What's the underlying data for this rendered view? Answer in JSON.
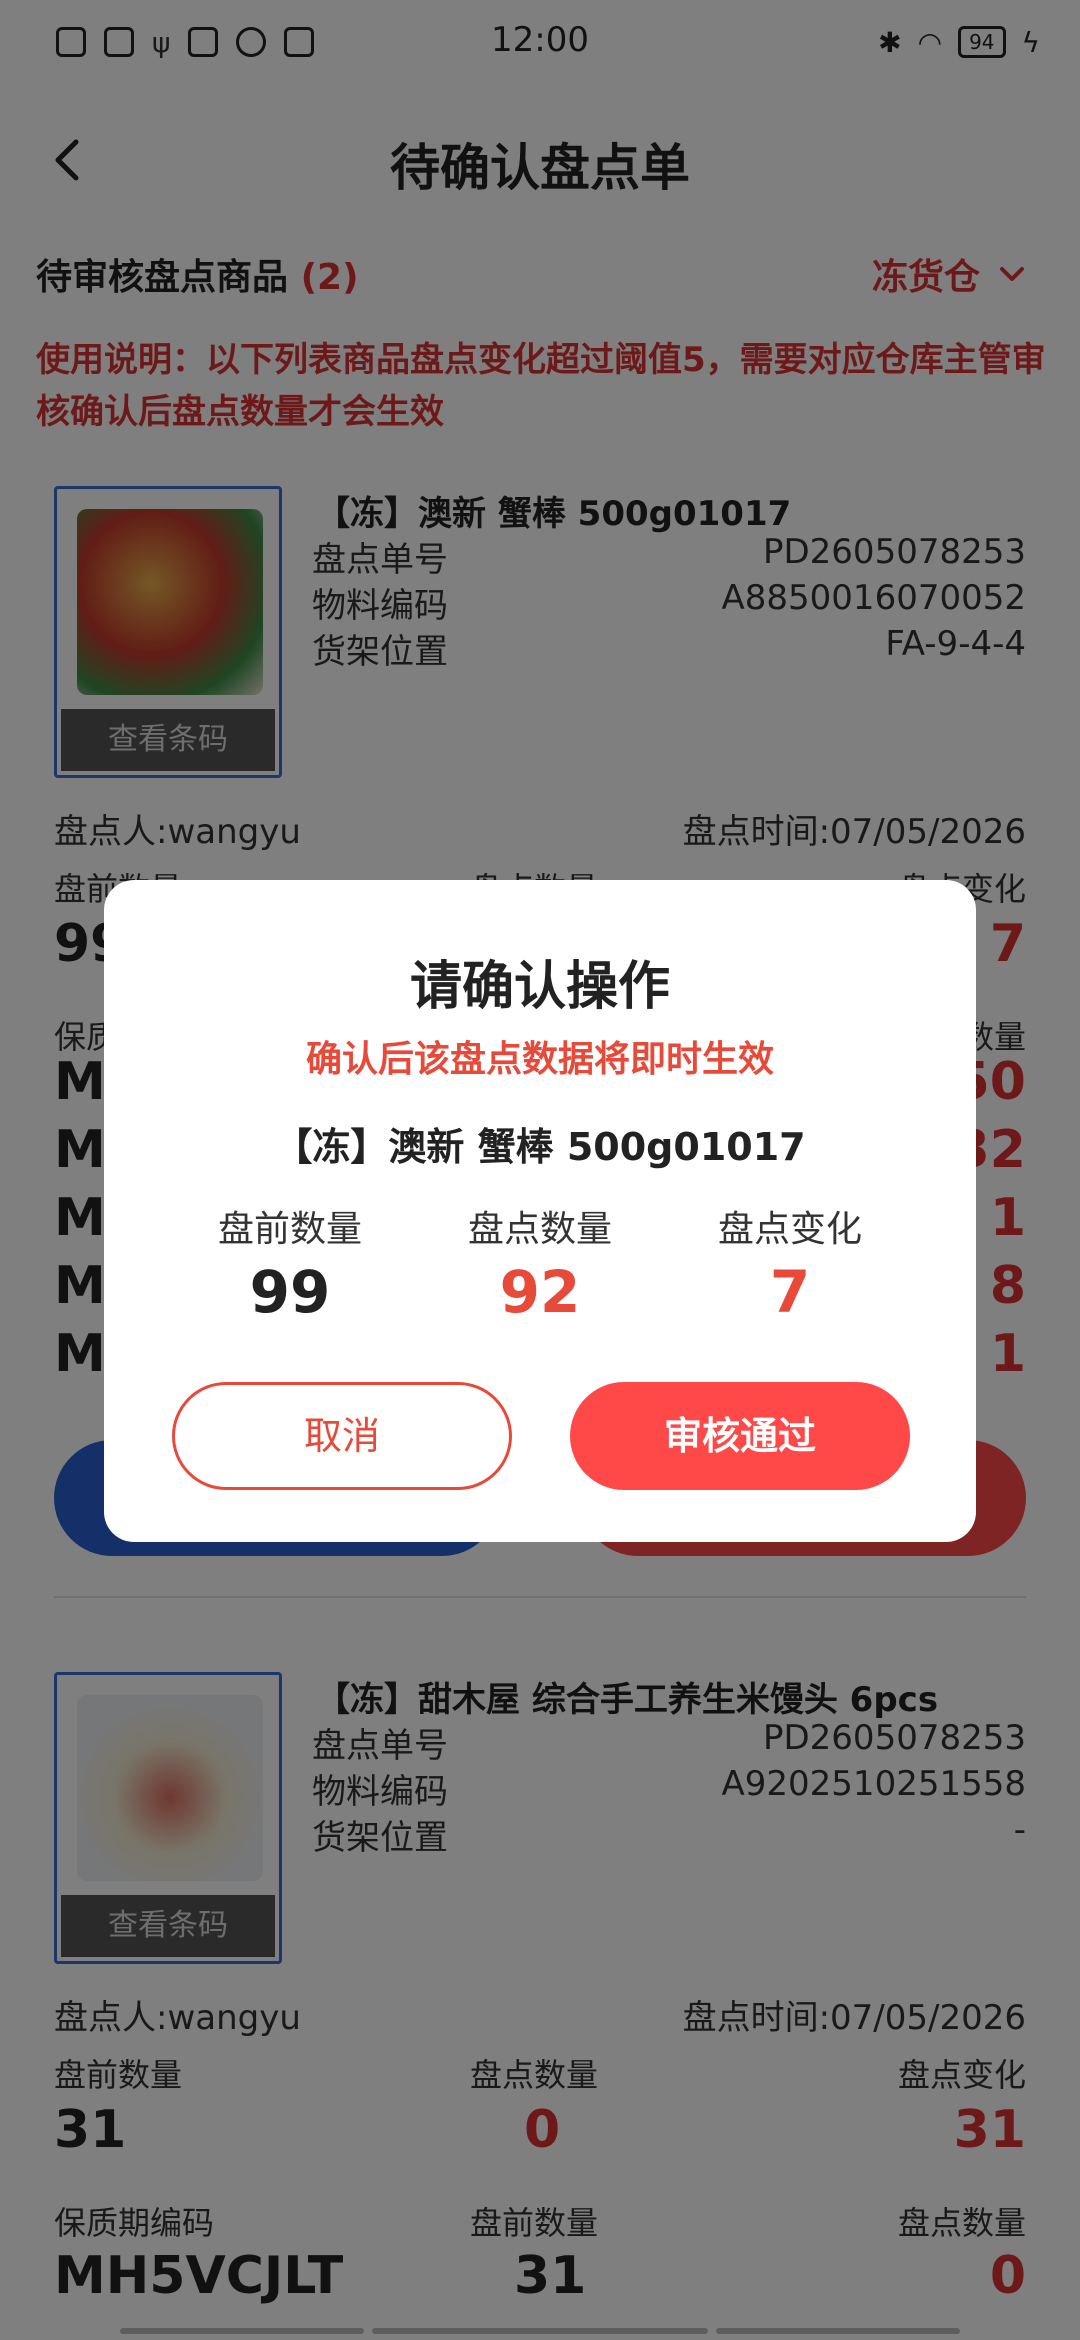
{
  "status_bar": {
    "time": "12:00",
    "battery": "94"
  },
  "header": {
    "title": "待确认盘点单",
    "back_icon": "chevron-left-icon"
  },
  "pending": {
    "label": "待审核盘点商品",
    "count": "(2)"
  },
  "warehouse": {
    "label": "冻货仓"
  },
  "notice": "使用说明：以下列表商品盘点变化超过阈值5，需要对应仓库主管审核确认后盘点数量才会生效",
  "cards": [
    {
      "name": "【冻】澳新 蟹棒 500g01017",
      "barcode_btn": "查看条码",
      "rows": [
        {
          "label": "盘点单号",
          "value": "PD2605078253"
        },
        {
          "label": "物料编码",
          "value": "A8850016070052"
        },
        {
          "label": "货架位置",
          "value": "FA-9-4-4"
        }
      ],
      "operator": "盘点人:wangyu",
      "time": "盘点时间:07/05/2026",
      "qty_labels": [
        "盘前数量",
        "盘点数量",
        "盘点变化"
      ],
      "qty_values": [
        "99",
        "92",
        "7"
      ],
      "batch_label_first": "保质",
      "batch_label_last": "数量",
      "batch_codes": [
        "M",
        "M",
        "M",
        "M",
        "M"
      ],
      "batch_values": [
        "50",
        "32",
        "1",
        "8",
        "1"
      ]
    },
    {
      "name": "【冻】甜木屋 综合手工养生米馒头 6pcs",
      "barcode_btn": "查看条码",
      "rows": [
        {
          "label": "盘点单号",
          "value": "PD2605078253"
        },
        {
          "label": "物料编码",
          "value": "A9202510251558"
        },
        {
          "label": "货架位置",
          "value": "-"
        }
      ],
      "operator": "盘点人:wangyu",
      "time": "盘点时间:07/05/2026",
      "qty_labels": [
        "盘前数量",
        "盘点数量",
        "盘点变化"
      ],
      "qty_values": [
        "31",
        "0",
        "31"
      ],
      "batch_labels": [
        "保质期编码",
        "盘前数量",
        "盘点数量"
      ],
      "batch_values": [
        "MH5VCJLT",
        "31",
        "0"
      ]
    }
  ],
  "dialog": {
    "title": "请确认操作",
    "subtitle": "确认后该盘点数据将即时生效",
    "product": "【冻】澳新 蟹棒 500g01017",
    "labels": [
      "盘前数量",
      "盘点数量",
      "盘点变化"
    ],
    "values": [
      "99",
      "92",
      "7"
    ],
    "cancel": "取消",
    "approve": "审核通过"
  },
  "colors": {
    "accent_red": "#d33333",
    "button_red": "#ff4848",
    "blue": "#2a5fd0"
  }
}
